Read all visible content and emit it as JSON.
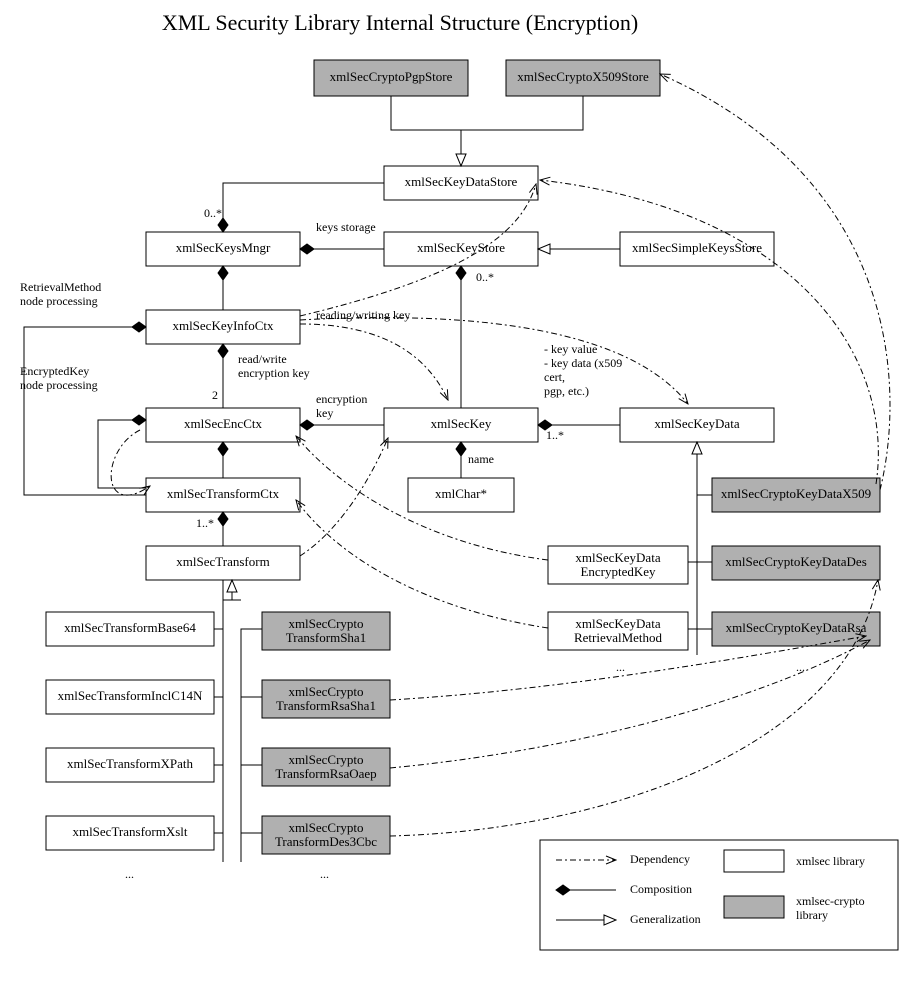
{
  "title": "XML Security Library Internal Structure (Encryption)",
  "nodes": {
    "pgpStore": "xmlSecCryptoPgpStore",
    "x509Store": "xmlSecCryptoX509Store",
    "keyDataStore": "xmlSecKeyDataStore",
    "keysMngr": "xmlSecKeysMngr",
    "keyStore": "xmlSecKeyStore",
    "simpleKeysStore": "xmlSecSimpleKeysStore",
    "keyInfoCtx": "xmlSecKeyInfoCtx",
    "encCtx": "xmlSecEncCtx",
    "key": "xmlSecKey",
    "keyData": "xmlSecKeyData",
    "transformCtx": "xmlSecTransformCtx",
    "xmlChar": "xmlChar*",
    "kdX509": "xmlSecCryptoKeyDataX509",
    "transform": "xmlSecTransform",
    "kdEncKey_l1": "xmlSecKeyData",
    "kdEncKey_l2": "EncryptedKey",
    "kdDes": "xmlSecCryptoKeyDataDes",
    "tBase64": "xmlSecTransformBase64",
    "ctSha1_l1": "xmlSecCrypto",
    "ctSha1_l2": "TransformSha1",
    "kdRetr_l1": "xmlSecKeyData",
    "kdRetr_l2": "RetrievalMethod",
    "kdRsa": "xmlSecCryptoKeyDataRsa",
    "tInclC14N": "xmlSecTransformInclC14N",
    "ctRsaSha1_l1": "xmlSecCrypto",
    "ctRsaSha1_l2": "TransformRsaSha1",
    "tXPath": "xmlSecTransformXPath",
    "ctRsaOaep_l1": "xmlSecCrypto",
    "ctRsaOaep_l2": "TransformRsaOaep",
    "tXslt": "xmlSecTransformXslt",
    "ctDes3Cbc_l1": "xmlSecCrypto",
    "ctDes3Cbc_l2": "TransformDes3Cbc"
  },
  "labels": {
    "multi0": "0..*",
    "multi0b": "0..*",
    "keysStorage": "keys storage",
    "retrMethod_l1": "RetrievalMethod",
    "retrMethod_l2": "node processing",
    "encKey_l1": "EncryptedKey",
    "encKey_l2": "node processing",
    "readWriteKey": "reading/writing key",
    "readWrite_l1": "read/write",
    "readWrite_l2": "encryption key",
    "two": "2",
    "encryption_l1": "encryption",
    "encryption_l2": "key",
    "name": "name",
    "one": "1..*",
    "oneb": "1..*",
    "kv_l1": "- key value",
    "kv_l2": "- key data (x509",
    "kv_l3": "cert,",
    "kv_l4": "pgp, etc.)",
    "dots": "...",
    "dots2": "...",
    "dots3": "...",
    "dots4": "..."
  },
  "legend": {
    "dependency": "Dependency",
    "composition": "Composition",
    "generalization": "Generalization",
    "xmlsec": "xmlsec library",
    "crypto_l1": "xmlsec-crypto",
    "crypto_l2": "library"
  }
}
